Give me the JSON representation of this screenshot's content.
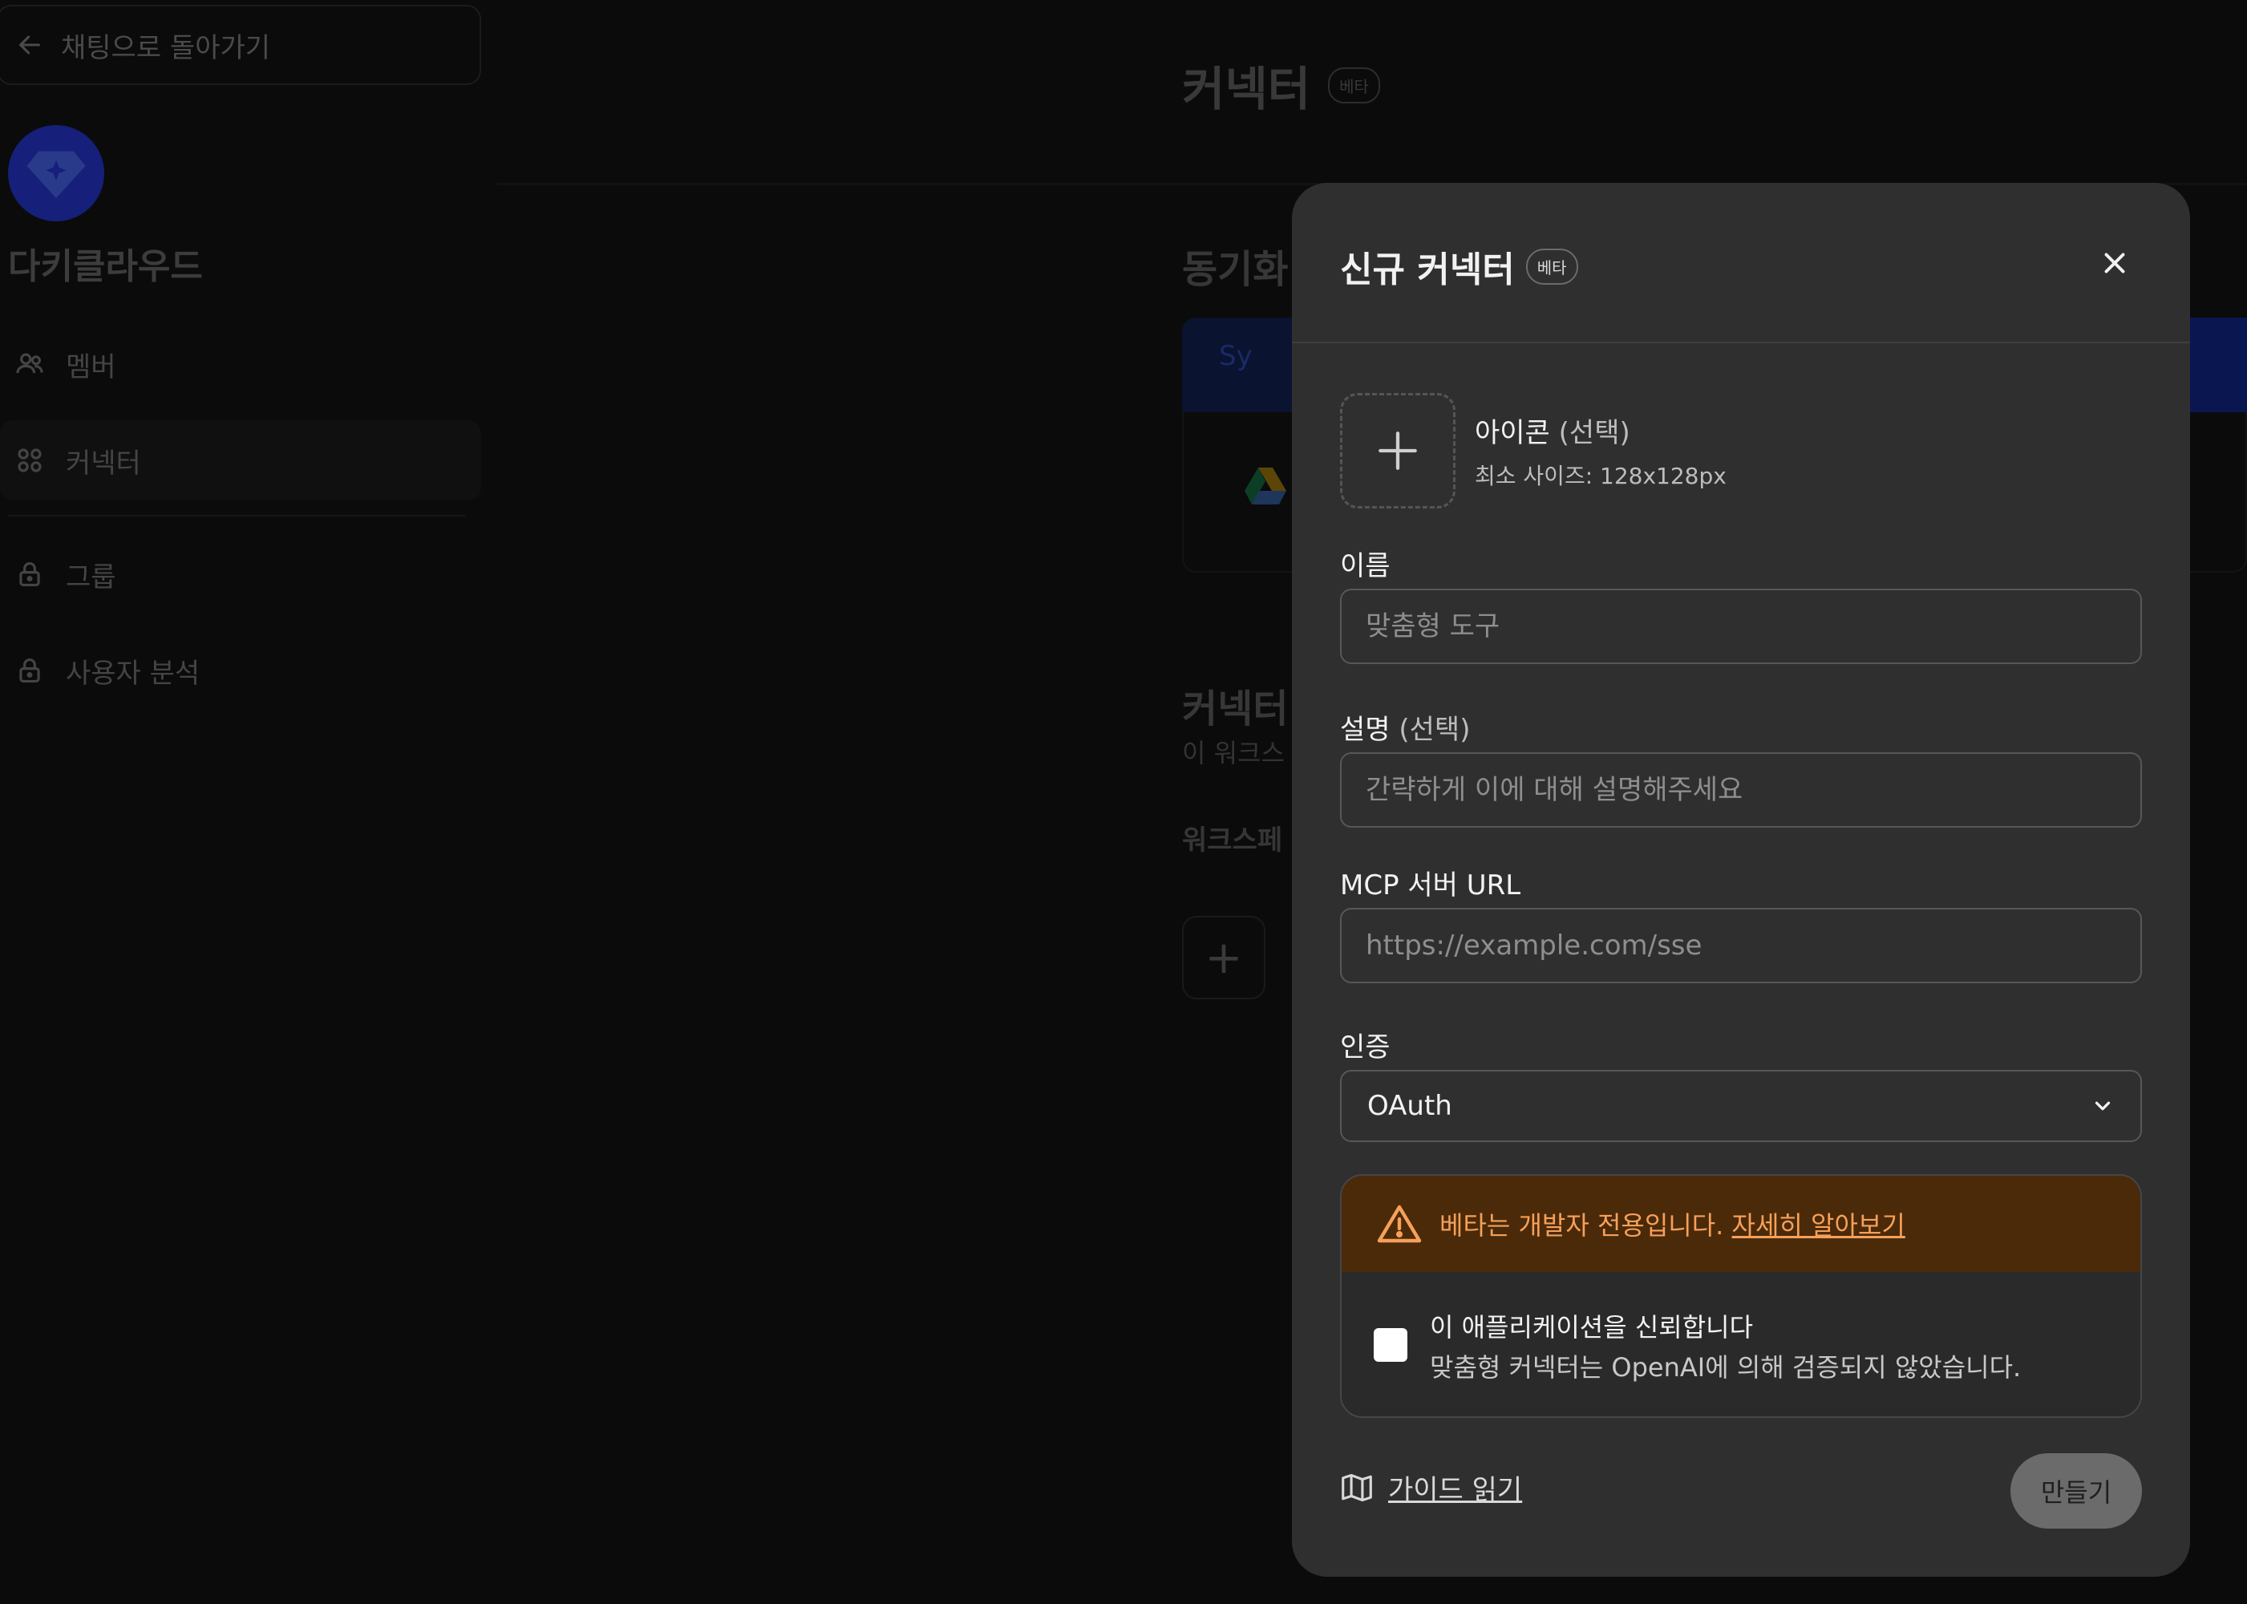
{
  "background": {
    "back_label": "채팅으로 돌아가기",
    "workspace_name": "다키클라우드",
    "sidebar_items": [
      {
        "label": "멤버",
        "icon": "users-icon"
      },
      {
        "label": "커넥터",
        "icon": "connectors-icon"
      },
      {
        "label": "그룹",
        "icon": "lock-icon"
      },
      {
        "label": "사용자 분석",
        "icon": "lock-icon"
      }
    ],
    "page_title": "커넥터",
    "page_badge": "베타",
    "section_sync": "동기화",
    "sync_banner": "Sy",
    "section_connectors": "커넥터",
    "connectors_sub": "이 워크스",
    "workspace_sub": "워크스페"
  },
  "modal": {
    "title": "신규 커넥터",
    "badge": "베타",
    "icon_field": {
      "label": "아이콘",
      "optional": "(선택)",
      "hint": "최소 사이즈: 128x128px"
    },
    "name_field": {
      "label": "이름",
      "placeholder": "맞춤형 도구",
      "value": ""
    },
    "description_field": {
      "label": "설명",
      "optional": "(선택)",
      "placeholder": "간략하게 이에 대해 설명해주세요",
      "value": ""
    },
    "url_field": {
      "label": "MCP 서버 URL",
      "placeholder": "https://example.com/sse",
      "value": ""
    },
    "auth_field": {
      "label": "인증",
      "selected": "OAuth"
    },
    "warning": {
      "text": "베타는 개발자 전용입니다.",
      "link": "자세히 알아보기",
      "color": "#f6a05a",
      "background": "#4b2a09"
    },
    "trust": {
      "title": "이 애플리케이션을 신뢰합니다",
      "subtitle": "맞춤형 커넥터는 OpenAI에 의해 검증되지 않았습니다.",
      "checked": false
    },
    "guide_link": "가이드 읽기",
    "create_button": "만들기"
  }
}
